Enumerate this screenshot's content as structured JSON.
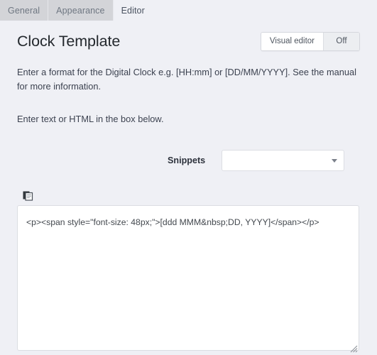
{
  "tabs": [
    {
      "label": "General",
      "active": false
    },
    {
      "label": "Appearance",
      "active": false
    },
    {
      "label": "Editor",
      "active": true
    }
  ],
  "header": {
    "title": "Clock Template",
    "visual_editor_label": "Visual editor",
    "visual_editor_state": "Off"
  },
  "descriptions": {
    "line1": "Enter a format for the Digital Clock e.g. [HH:mm] or [DD/MM/YYYY]. See the manual for more information.",
    "line2": "Enter text or HTML in the box below."
  },
  "snippets": {
    "label": "Snippets",
    "selected_value": "",
    "placeholder": "",
    "chevron_icon": "chevron-down-icon"
  },
  "editor": {
    "copy_icon": "copy-icon",
    "content": "<p><span style=\"font-size: 48px;\">[ddd MMM&nbsp;DD, YYYY]</span></p>",
    "placeholder": "",
    "resize_handle_icon": "resize-grip-icon"
  },
  "colors": {
    "page_background": "#eff0f5",
    "tabstrip_background": "#d3d4d8",
    "active_tab_background": "#eff0f5",
    "field_background": "#ffffff",
    "border": "#dcdee3",
    "text": "#32373c",
    "muted_text": "#6f7782"
  }
}
